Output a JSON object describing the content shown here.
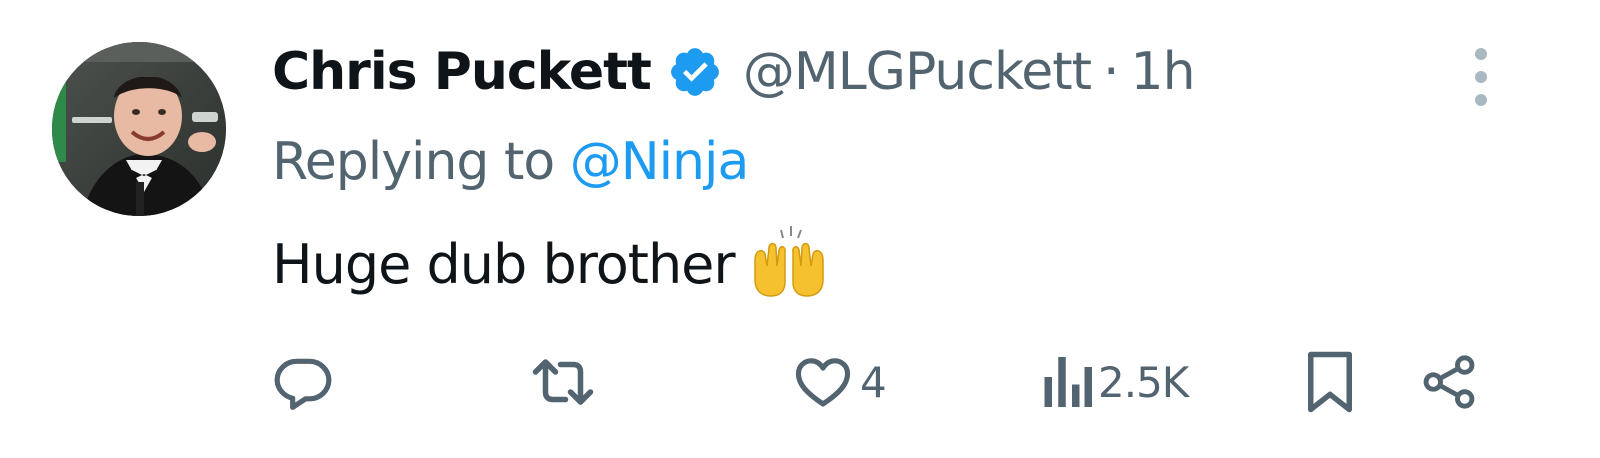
{
  "tweet": {
    "display_name": "Chris Puckett",
    "verified": true,
    "handle": "@MLGPuckett",
    "separator": "·",
    "time": "1h",
    "replying_prefix": "Replying to",
    "replying_to": "@Ninja",
    "text": "Huge dub brother",
    "emoji": "raising-hands"
  },
  "actions": {
    "reply_icon": "reply-icon",
    "retweet_icon": "retweet-icon",
    "like_icon": "heart-icon",
    "like_count": "4",
    "views_icon": "views-icon",
    "views_count": "2.5K",
    "bookmark_icon": "bookmark-icon",
    "share_icon": "share-icon"
  },
  "colors": {
    "name": "#0f1419",
    "secondary": "#536471",
    "link": "#1d9bf0",
    "verified": "#1d9bf0",
    "emoji": "#f6c12e"
  }
}
